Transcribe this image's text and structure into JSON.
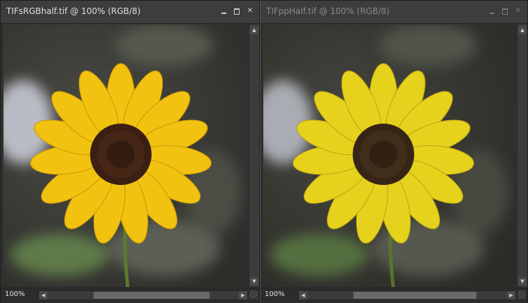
{
  "left_window": {
    "title": "TIFsRGBhalf.tif @ 100% (RGB/8)",
    "zoom": "100%",
    "petal_color": "#f1c20f",
    "petal_shadow": "#c8950a"
  },
  "right_window": {
    "title": "TIFppHalf.tif @ 100% (RGB/8)",
    "zoom": "100%",
    "petal_color": "#e6d11d",
    "petal_shadow": "#b9a311"
  },
  "icons": {
    "minimize": "minimize-icon",
    "maximize": "maximize-icon",
    "close": "close-icon",
    "scroll_up": "arrow-up-icon",
    "scroll_down": "arrow-down-icon",
    "scroll_left": "arrow-left-icon",
    "scroll_right": "arrow-right-icon"
  },
  "colors": {
    "flower_center": "#3a1f12",
    "background_blur": "#3b3c38"
  }
}
